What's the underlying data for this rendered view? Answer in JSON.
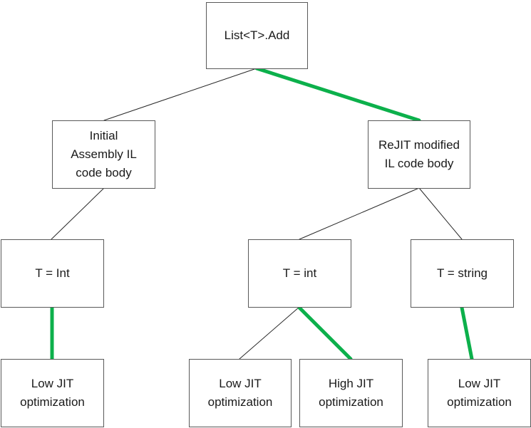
{
  "diagram": {
    "type": "tree",
    "colors": {
      "highlight_edge": "#0cb04b",
      "normal_edge": "#262626",
      "node_border": "#595959"
    },
    "nodes": [
      {
        "id": "root",
        "label": "List<T>.Add"
      },
      {
        "id": "initial",
        "label": "Initial\nAssembly IL\ncode body"
      },
      {
        "id": "rejit",
        "label": "ReJIT modified\nIL code body"
      },
      {
        "id": "tint-l",
        "label": "T = Int"
      },
      {
        "id": "tint-m",
        "label": "T = int"
      },
      {
        "id": "tstring",
        "label": "T = string"
      },
      {
        "id": "low-l",
        "label": "Low JIT\noptimization"
      },
      {
        "id": "low-m",
        "label": "Low JIT\noptimization"
      },
      {
        "id": "high",
        "label": "High JIT\noptimization"
      },
      {
        "id": "low-r",
        "label": "Low JIT\noptimization"
      }
    ],
    "edges": [
      {
        "from": "root",
        "to": "initial",
        "highlighted": false
      },
      {
        "from": "root",
        "to": "rejit",
        "highlighted": true
      },
      {
        "from": "initial",
        "to": "tint-l",
        "highlighted": false
      },
      {
        "from": "rejit",
        "to": "tint-m",
        "highlighted": false
      },
      {
        "from": "rejit",
        "to": "tstring",
        "highlighted": false
      },
      {
        "from": "tint-l",
        "to": "low-l",
        "highlighted": true
      },
      {
        "from": "tint-m",
        "to": "low-m",
        "highlighted": false
      },
      {
        "from": "tint-m",
        "to": "high",
        "highlighted": true
      },
      {
        "from": "tstring",
        "to": "low-r",
        "highlighted": true
      }
    ]
  }
}
